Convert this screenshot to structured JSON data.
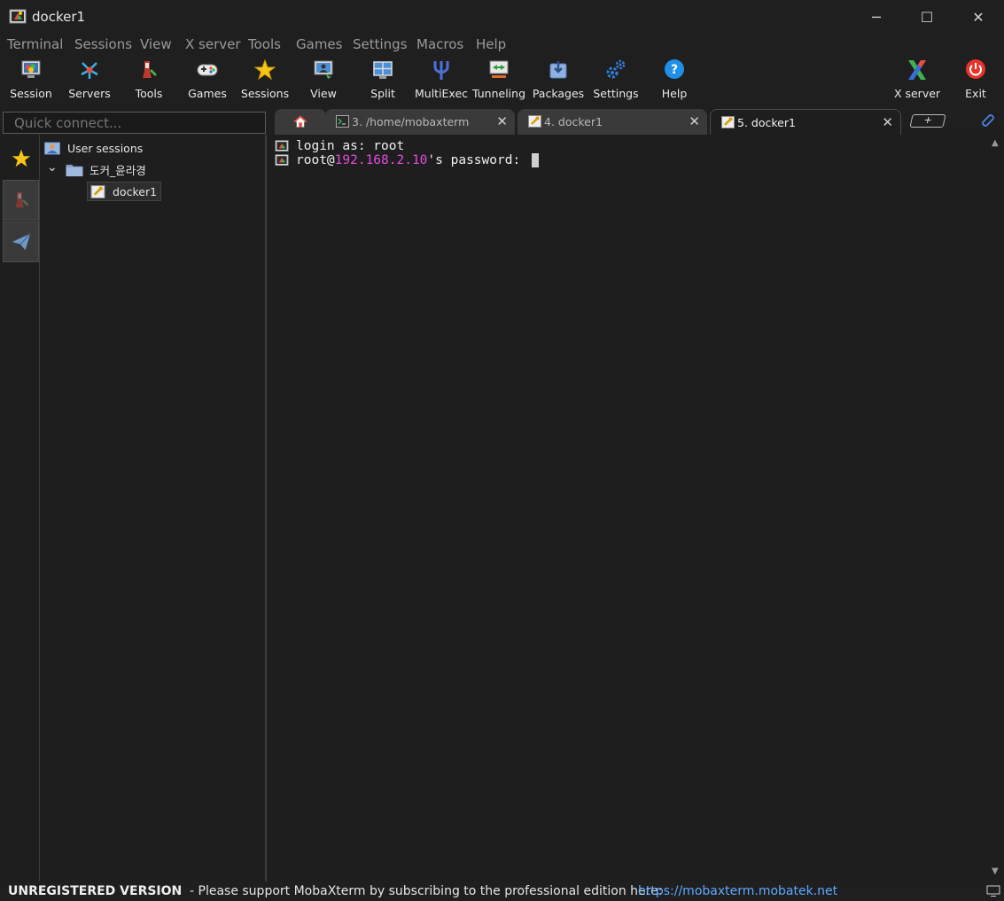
{
  "window": {
    "title": "docker1",
    "minimize_glyph": "─",
    "maximize_glyph": "☐",
    "close_glyph": "✕"
  },
  "menu": [
    "Terminal",
    "Sessions",
    "View",
    "X server",
    "Tools",
    "Games",
    "Settings",
    "Macros",
    "Help"
  ],
  "toolbar": {
    "session": "Session",
    "servers": "Servers",
    "tools": "Tools",
    "games": "Games",
    "sessions": "Sessions",
    "view": "View",
    "split": "Split",
    "multiexec": "MultiExec",
    "tunneling": "Tunneling",
    "packages": "Packages",
    "settings": "Settings",
    "help": "Help",
    "xserver": "X server",
    "exit": "Exit"
  },
  "quick_connect": {
    "placeholder": "Quick connect..."
  },
  "tabs": [
    {
      "label": "3. /home/mobaxterm",
      "close": "✕"
    },
    {
      "label": "4. docker1",
      "close": "✕"
    },
    {
      "label": "5. docker1",
      "close": "✕",
      "active": true
    }
  ],
  "new_tab_glyph": "+",
  "session_tree": {
    "root": "User sessions",
    "folder": "도커_윤라경",
    "session": "docker1",
    "expand_glyph": "⌄"
  },
  "terminal": {
    "line1": "login as: root",
    "line2_prefix": "root@",
    "line2_ip": "192.168.2.10",
    "line2_suffix": "'s password: "
  },
  "status": {
    "unregistered": "UNREGISTERED VERSION",
    "message": "-  Please support MobaXterm by subscribing to the professional edition here:",
    "link": "https://mobaxterm.mobatek.net"
  },
  "colors": {
    "background": "#1e1e1e",
    "ip_highlight": "#e24ce0",
    "link": "#5fa8ff",
    "star": "#f5c518"
  }
}
